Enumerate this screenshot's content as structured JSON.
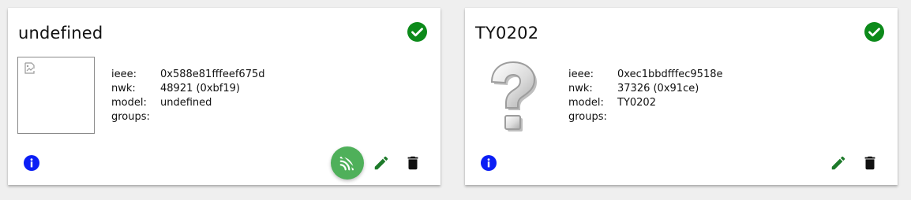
{
  "devices": [
    {
      "title": "undefined",
      "status_icon": "check-circle-icon",
      "image": "broken-image-icon",
      "info": {
        "ieee_label": "ieee:",
        "ieee": "0x588e81fffeef675d",
        "nwk_label": "nwk:",
        "nwk": "48921 (0xbf19)",
        "model_label": "model:",
        "model": "undefined",
        "groups_label": "groups:",
        "groups": ""
      },
      "actions": [
        "info-icon",
        "permit-join-icon",
        "edit-icon",
        "delete-icon"
      ]
    },
    {
      "title": "TY0202",
      "status_icon": "check-circle-icon",
      "image": "question-mark-icon",
      "info": {
        "ieee_label": "ieee:",
        "ieee": "0xec1bbdfffec9518e",
        "nwk_label": "nwk:",
        "nwk": "37326 (0x91ce)",
        "model_label": "model:",
        "model": "TY0202",
        "groups_label": "groups:",
        "groups": ""
      },
      "actions": [
        "info-icon",
        "edit-icon",
        "delete-icon"
      ]
    }
  ],
  "colors": {
    "status_ok": "#0c8a1a",
    "info": "#0b1ef5",
    "fab": "#4fb05a",
    "edit": "#1d7a2a",
    "delete": "#111111"
  }
}
